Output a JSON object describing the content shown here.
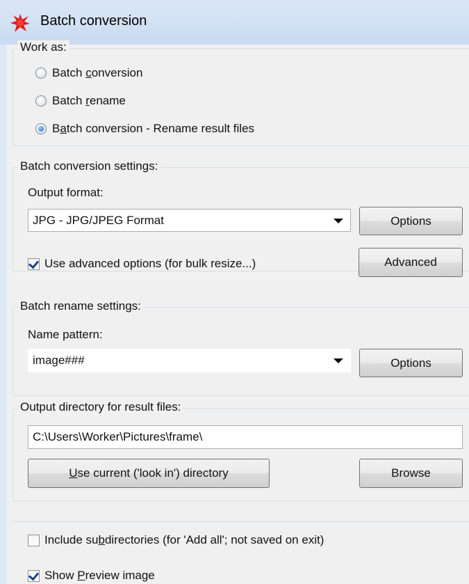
{
  "window": {
    "title": "Batch conversion",
    "icon": "red-splat-app-icon"
  },
  "work_as": {
    "legend": "Work as:",
    "options": [
      {
        "pre": "Batch ",
        "key": "c",
        "post": "onversion",
        "selected": false
      },
      {
        "pre": "Batch ",
        "key": "r",
        "post": "ename",
        "selected": false
      },
      {
        "pre": "B",
        "key": "a",
        "post": "tch conversion - Rename result files",
        "selected": true
      }
    ]
  },
  "conversion": {
    "legend": "Batch conversion settings:",
    "format_label": "Output format:",
    "format_value": "JPG - JPG/JPEG Format",
    "options_button": "Options",
    "advanced_checkbox": "Use advanced options (for bulk resize...)",
    "advanced_checked": true,
    "advanced_button": "Advanced"
  },
  "rename": {
    "legend": "Batch rename settings:",
    "pattern_label": "Name pattern:",
    "pattern_value": "image###",
    "options_button": "Options"
  },
  "output": {
    "legend": "Output directory for result files:",
    "directory": "C:\\Users\\Worker\\Pictures\\frame\\",
    "use_current_key": "U",
    "use_current_rest": "se current ('look in') directory",
    "browse_button": "Browse"
  },
  "extras": {
    "subdirs_pre": "Include su",
    "subdirs_key": "b",
    "subdirs_post": "directories (for 'Add all'; not saved on exit)",
    "subdirs_checked": false,
    "preview_pre": "Show ",
    "preview_key": "P",
    "preview_post": "review image",
    "preview_checked": true
  }
}
